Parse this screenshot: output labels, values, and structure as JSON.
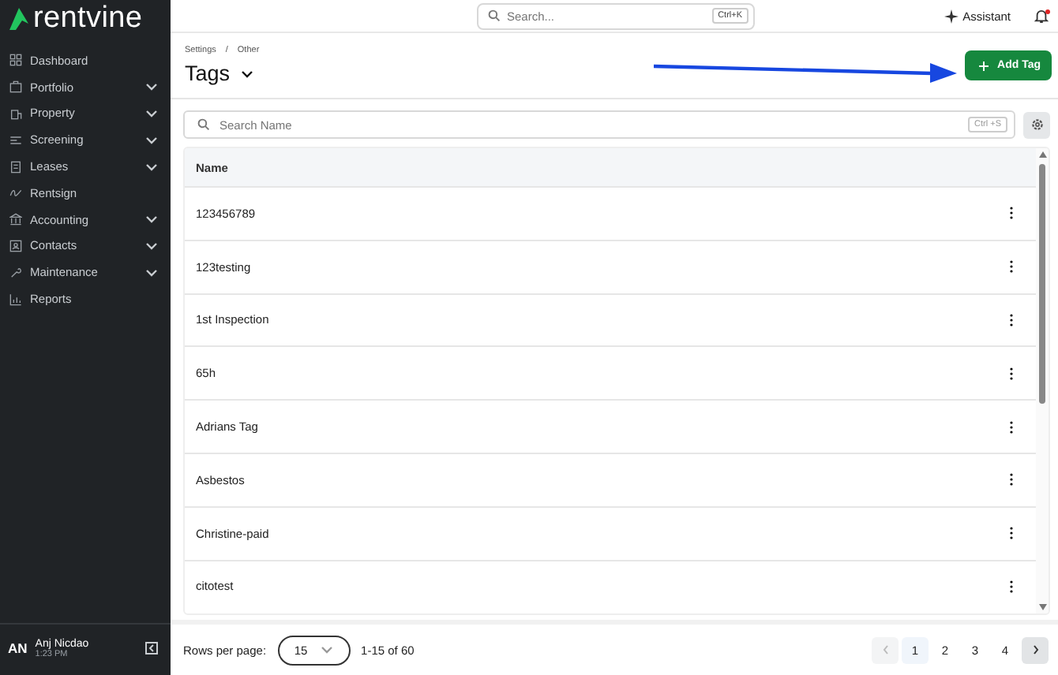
{
  "sidebar": {
    "logo": "rentvine",
    "items": [
      {
        "label": "Dashboard",
        "expandable": false
      },
      {
        "label": "Portfolio",
        "expandable": true
      },
      {
        "label": "Property",
        "expandable": true
      },
      {
        "label": "Screening",
        "expandable": true
      },
      {
        "label": "Leases",
        "expandable": true
      },
      {
        "label": "Rentsign",
        "expandable": false
      },
      {
        "label": "Accounting",
        "expandable": true
      },
      {
        "label": "Contacts",
        "expandable": true
      },
      {
        "label": "Maintenance",
        "expandable": true
      },
      {
        "label": "Reports",
        "expandable": false
      }
    ],
    "user": {
      "initials": "AN",
      "name": "Anj Nicdao",
      "time": "1:23 PM"
    }
  },
  "topbar": {
    "search": {
      "placeholder": "Search...",
      "shortcut": "Ctrl+K"
    },
    "assistant": "Assistant",
    "notification_dot": true
  },
  "header": {
    "breadcrumb": [
      "Settings",
      "Other"
    ],
    "separator": "/",
    "title": "Tags",
    "add_button": "Add Tag"
  },
  "filter": {
    "placeholder": "Search Name",
    "shortcut": "Ctrl +S"
  },
  "table": {
    "columns": [
      "Name"
    ],
    "rows": [
      {
        "name": "123456789"
      },
      {
        "name": "123testing"
      },
      {
        "name": "1st Inspection"
      },
      {
        "name": "65h"
      },
      {
        "name": "Adrians Tag"
      },
      {
        "name": "Asbestos"
      },
      {
        "name": "Christine-paid"
      },
      {
        "name": "citotest"
      }
    ]
  },
  "footer": {
    "rows_label": "Rows per page:",
    "rows_value": "15",
    "range": "1-15 of 60",
    "pages": [
      {
        "label": "1",
        "selected": true
      },
      {
        "label": "2",
        "selected": false
      },
      {
        "label": "3",
        "selected": false
      },
      {
        "label": "4",
        "selected": false
      }
    ],
    "prev_disabled": true,
    "next_disabled": false
  }
}
